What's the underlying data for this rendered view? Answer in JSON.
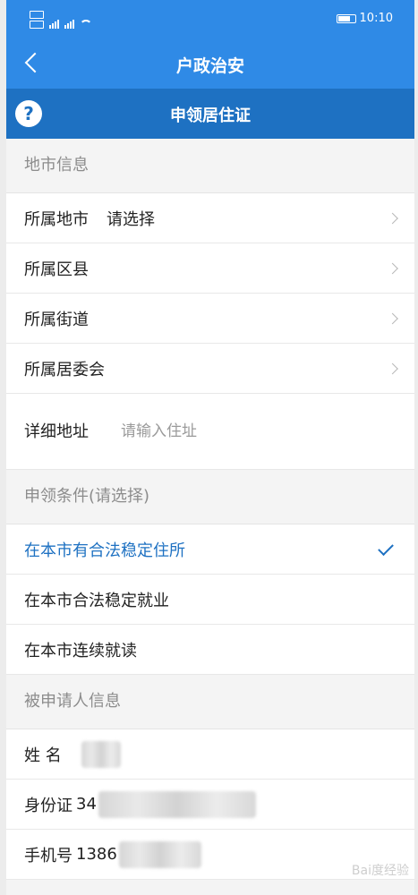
{
  "status_bar": {
    "time": "10:10"
  },
  "nav": {
    "title": "户政治安"
  },
  "sub_header": {
    "title": "申领居住证"
  },
  "location_section": {
    "header": "地市信息",
    "city": {
      "label": "所属地市",
      "value": "请选择"
    },
    "district": {
      "label": "所属区县"
    },
    "street": {
      "label": "所属街道"
    },
    "committee": {
      "label": "所属居委会"
    },
    "address": {
      "label": "详细地址",
      "placeholder": "请输入住址"
    }
  },
  "conditions_section": {
    "header": "申领条件(请选择)",
    "options": [
      {
        "label": "在本市有合法稳定住所",
        "selected": true
      },
      {
        "label": "在本市合法稳定就业",
        "selected": false
      },
      {
        "label": "在本市连续就读",
        "selected": false
      }
    ]
  },
  "applicant_section": {
    "header": "被申请人信息",
    "name": {
      "label": "姓 名"
    },
    "id_card": {
      "label": "身份证",
      "value_visible": "34"
    },
    "phone": {
      "label": "手机号",
      "value_visible": "1386"
    }
  },
  "watermark": "Bai度经验",
  "colors": {
    "primary": "#2f8ae6",
    "primary_dark": "#1e71c2",
    "selected": "#1e71c2"
  }
}
